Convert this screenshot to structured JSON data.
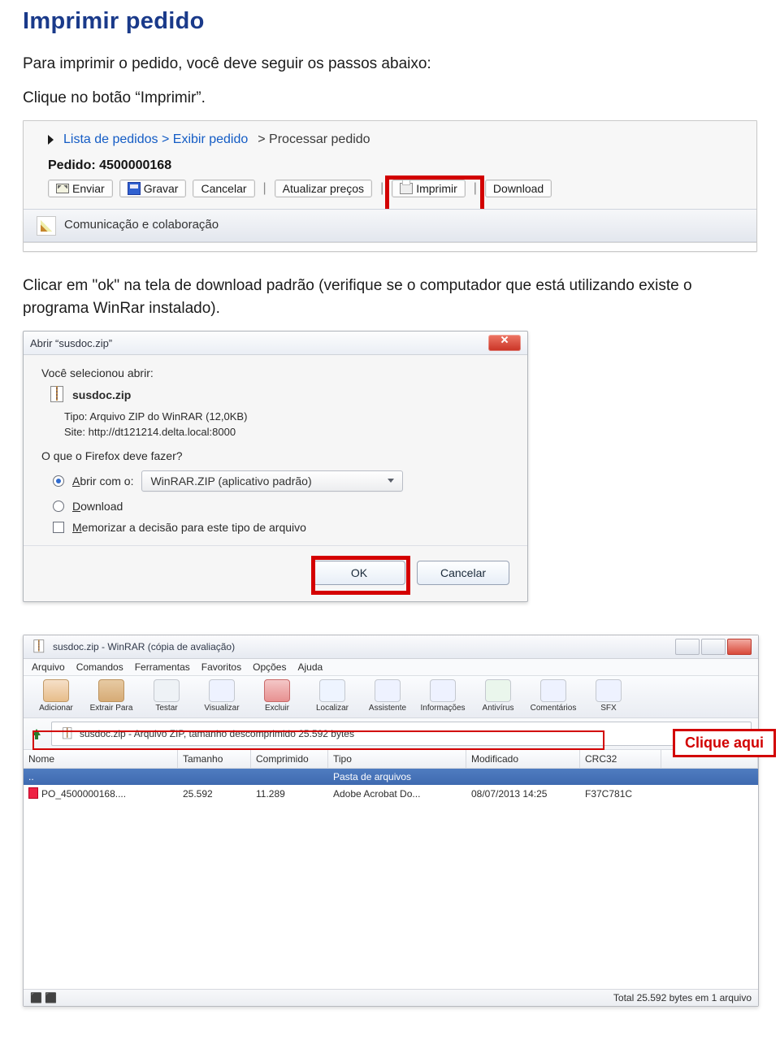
{
  "heading": "Imprimir pedido",
  "intro_line1": "Para imprimir o pedido, você deve seguir os passos abaixo:",
  "intro_line2": "Clique no botão “Imprimir”.",
  "body2": "Clicar em \"ok\" na tela de download padrão (verifique se o computador que está utilizando existe o programa WinRar instalado).",
  "toolbar": {
    "breadcrumb_link": "Lista de pedidos > Exibir pedido",
    "breadcrumb_rest": " > Processar pedido",
    "order_label": "Pedido: 4500000168",
    "actions": {
      "enviar": "Enviar",
      "gravar": "Gravar",
      "cancelar": "Cancelar",
      "atualizar": "Atualizar preços",
      "imprimir": "Imprimir",
      "download": "Download"
    },
    "comm": "Comunicação e colaboração"
  },
  "ff": {
    "title": "Abrir “susdoc.zip”",
    "selected": "Você selecionou abrir:",
    "file": "susdoc.zip",
    "type_line": "Tipo:  Arquivo ZIP do WinRAR (12,0KB)",
    "site_line": "Site:  http://dt121214.delta.local:8000",
    "question": "O que o Firefox deve fazer?",
    "open_prefix": "A",
    "open_rest": "brir com o:",
    "open_select": "WinRAR.ZIP (aplicativo padrão)",
    "download_prefix": "D",
    "download_rest": "ownload",
    "mem_prefix": "M",
    "mem_rest": "emorizar a decisão para este tipo de arquivo",
    "ok": "OK",
    "cancel": "Cancelar"
  },
  "wr": {
    "title": "susdoc.zip - WinRAR (cópia de avaliação)",
    "menu": [
      "Arquivo",
      "Comandos",
      "Ferramentas",
      "Favoritos",
      "Opções",
      "Ajuda"
    ],
    "tools": [
      "Adicionar",
      "Extrair Para",
      "Testar",
      "Visualizar",
      "Excluir",
      "Localizar",
      "Assistente",
      "Informações",
      "Antivírus",
      "Comentários",
      "SFX"
    ],
    "pathbox": "susdoc.zip - Arquivo ZIP, tamanho descomprimido 25.592 bytes",
    "cols": [
      "Nome",
      "Tamanho",
      "Comprimido",
      "Tipo",
      "Modificado",
      "CRC32",
      ""
    ],
    "folder_row": {
      "nome": "..",
      "tipo": "Pasta de arquivos"
    },
    "file_row": {
      "nome": "PO_4500000168....",
      "tamanho": "25.592",
      "comprimido": "11.289",
      "tipo": "Adobe Acrobat Do...",
      "modificado": "08/07/2013 14:25",
      "crc": "F37C781C"
    },
    "status_right": "Total 25.592 bytes em 1 arquivo",
    "callout": "Clique aqui"
  }
}
